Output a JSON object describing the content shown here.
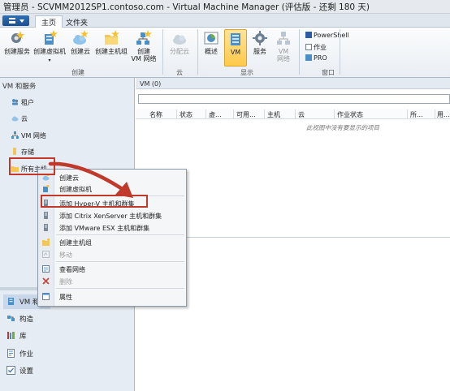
{
  "window": {
    "title": "管理员 - SCVMM2012SP1.contoso.com - Virtual Machine Manager (评估版 - 还剩 180 天)"
  },
  "ribbon_tabs": [
    {
      "label": "主页"
    },
    {
      "label": "文件夹"
    }
  ],
  "ribbon": {
    "create_group": {
      "label": "创建",
      "buttons": [
        {
          "label": "创建服务",
          "icon": "create-service-icon"
        },
        {
          "label": "创建虚拟机",
          "icon": "create-vm-icon"
        },
        {
          "label": "创建云",
          "icon": "create-cloud-icon"
        },
        {
          "label": "创建主机组",
          "icon": "create-host-group-icon"
        },
        {
          "label": "创建",
          "label2": "VM 网络",
          "icon": "create-vm-network-icon"
        }
      ]
    },
    "cloud_group": {
      "label": "云",
      "buttons": [
        {
          "label": "分配云",
          "icon": "assign-cloud-icon",
          "disabled": true
        }
      ]
    },
    "show_group": {
      "label": "显示",
      "buttons": [
        {
          "label": "概述",
          "icon": "overview-icon"
        },
        {
          "label": "VM",
          "icon": "vm-icon",
          "active": true
        },
        {
          "label": "服务",
          "icon": "service-icon"
        },
        {
          "label": "VM",
          "label2": "网络",
          "icon": "vm-network-icon",
          "disabled": true
        }
      ]
    },
    "window_group": {
      "label": "窗口",
      "buttons": [
        {
          "label": "PowerShell",
          "icon": "powershell-icon"
        },
        {
          "label": "作业",
          "icon": "jobs-icon"
        },
        {
          "label": "PRO",
          "icon": "pro-icon"
        }
      ]
    }
  },
  "left_nav": {
    "header": "VM 和服务",
    "items": [
      {
        "label": "租户",
        "icon": "tenant-icon"
      },
      {
        "label": "云",
        "icon": "cloud-icon"
      },
      {
        "label": "VM 网络",
        "icon": "vm-network-icon"
      },
      {
        "label": "存储",
        "icon": "storage-icon"
      },
      {
        "label": "所有主机",
        "icon": "folder-icon"
      }
    ],
    "workspaces": [
      {
        "label": "VM 和服务",
        "icon": "vms-services-icon",
        "active": true
      },
      {
        "label": "构造",
        "icon": "fabric-icon"
      },
      {
        "label": "库",
        "icon": "library-icon"
      },
      {
        "label": "作业",
        "icon": "jobs-icon"
      },
      {
        "label": "设置",
        "icon": "settings-icon"
      }
    ]
  },
  "main": {
    "header": "VM (0)",
    "columns": [
      "名称",
      "状态",
      "虚...",
      "可用...",
      "主机",
      "云",
      "作业状态",
      "所...",
      "用..."
    ],
    "empty_message": "此视图中没有要显示的项目"
  },
  "context_menu": {
    "items": [
      {
        "label": "创建云",
        "icon": "create-cloud-icon"
      },
      {
        "label": "创建虚拟机",
        "icon": "create-vm-icon"
      },
      {
        "separator": true
      },
      {
        "label": "添加 Hyper-V 主机和群集",
        "icon": "server-icon",
        "highlighted": true
      },
      {
        "label": "添加 Citrix XenServer 主机和群集",
        "icon": "server-icon"
      },
      {
        "label": "添加 VMware ESX 主机和群集",
        "icon": "server-icon"
      },
      {
        "separator": true
      },
      {
        "label": "创建主机组",
        "icon": "create-host-group-icon"
      },
      {
        "label": "移动",
        "icon": "move-icon",
        "disabled": true
      },
      {
        "separator": true
      },
      {
        "label": "查看网络",
        "icon": "view-network-icon"
      },
      {
        "label": "删除",
        "icon": "delete-icon",
        "disabled": true
      },
      {
        "separator": true
      },
      {
        "label": "属性",
        "icon": "properties-icon"
      }
    ]
  },
  "colors": {
    "accent_blue": "#1f5e9e",
    "annotation_red": "#c0392b",
    "active_button": "#ffc94a"
  }
}
